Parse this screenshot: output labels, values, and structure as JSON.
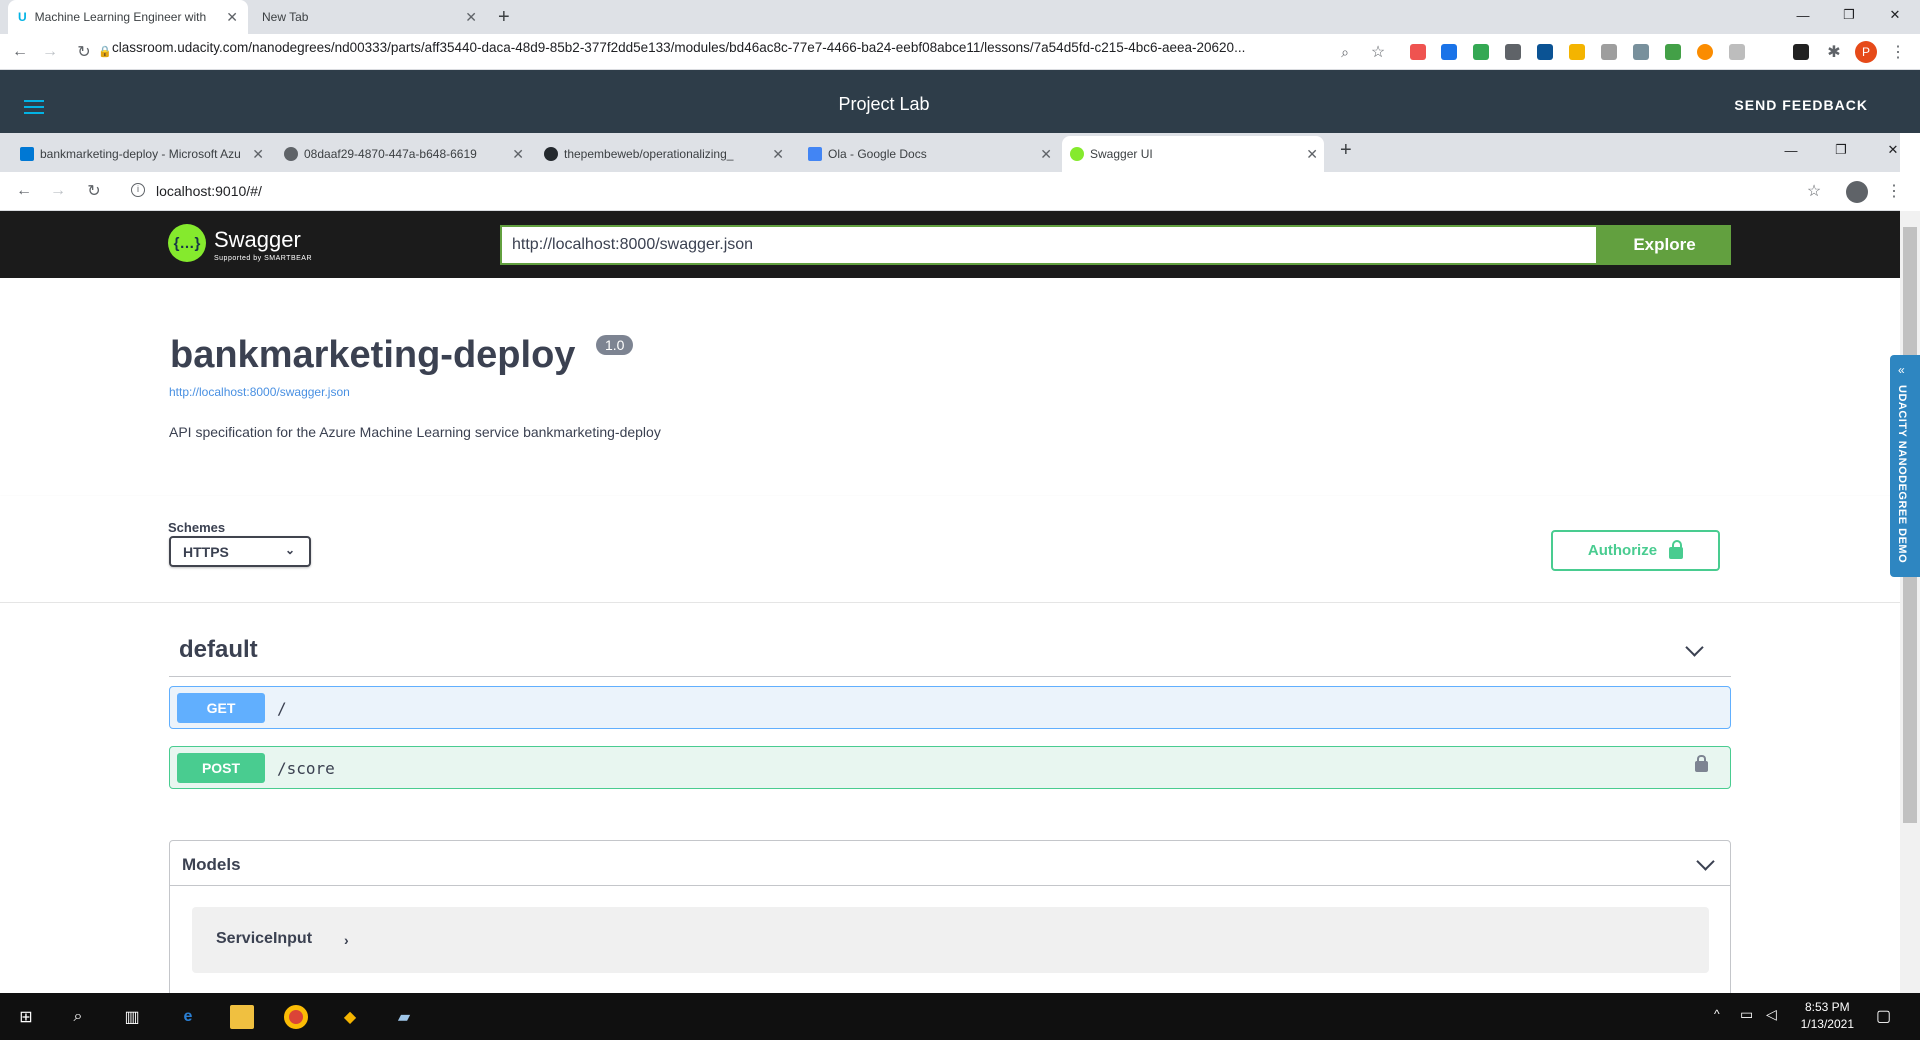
{
  "outer_browser": {
    "tabs": [
      {
        "title": "Machine Learning Engineer with",
        "active": true
      },
      {
        "title": "New Tab",
        "active": false
      }
    ],
    "url": "classroom.udacity.com/nanodegrees/nd00333/parts/aff35440-daca-48d9-85b2-377f2dd5e133/modules/bd46ac8c-77e7-4466-ba24-eebf08abce11/lessons/7a54d5fd-c215-4bc6-aeea-20620...",
    "profile_initial": "P"
  },
  "udacity": {
    "title": "Project Lab",
    "feedback": "SEND FEEDBACK",
    "demo_label": "UDACITY NANODEGREE DEMO"
  },
  "inner_browser": {
    "tabs": [
      {
        "title": "bankmarketing-deploy - Microsoft Azure"
      },
      {
        "title": "08daaf29-4870-447a-b648-6619"
      },
      {
        "title": "thepembeweb/operationalizing_"
      },
      {
        "title": "Ola - Google Docs"
      },
      {
        "title": "Swagger UI"
      }
    ],
    "url": "localhost:9010/#/"
  },
  "swagger": {
    "logo_text": "Swagger",
    "logo_sub": "Supported by SMARTBEAR",
    "spec_url": "http://localhost:8000/swagger.json",
    "explore": "Explore",
    "api_title": "bankmarketing-deploy",
    "version": "1.0",
    "api_link": "http://localhost:8000/swagger.json",
    "description": "API specification for the Azure Machine Learning service bankmarketing-deploy",
    "schemes_label": "Schemes",
    "scheme": "HTTPS",
    "authorize": "Authorize",
    "tag": "default",
    "operations": [
      {
        "method": "GET",
        "path": "/"
      },
      {
        "method": "POST",
        "path": "/score"
      }
    ],
    "models_title": "Models",
    "models": [
      "ServiceInput"
    ]
  },
  "taskbar": {
    "time": "8:53 PM",
    "date": "1/13/2021"
  }
}
